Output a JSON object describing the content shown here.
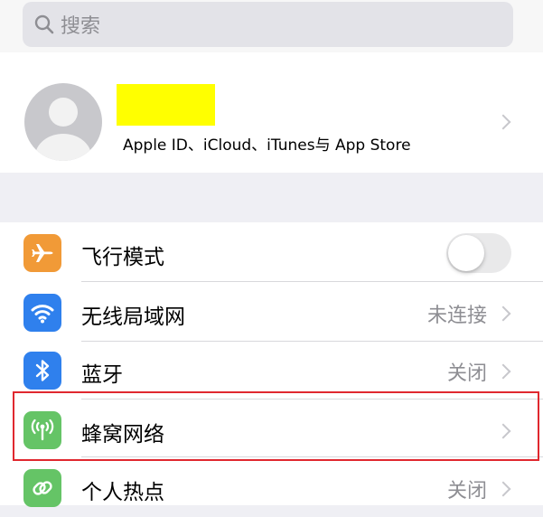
{
  "search": {
    "placeholder": "搜索",
    "icon": "search-icon"
  },
  "profile": {
    "subtitle": "Apple ID、iCloud、iTunes与 App Store",
    "name_redaction_color": "#ffff00",
    "avatar_icon": "person-silhouette-icon"
  },
  "settings": {
    "airplane": {
      "label": "飞行模式",
      "icon": "airplane-icon",
      "icon_color": "#f19a37",
      "toggle_on": false
    },
    "wifi": {
      "label": "无线局域网",
      "value": "未连接",
      "icon": "wifi-icon",
      "icon_color": "#2f80ed"
    },
    "bluetooth": {
      "label": "蓝牙",
      "value": "关闭",
      "icon": "bluetooth-icon",
      "icon_color": "#2f80ed"
    },
    "cellular": {
      "label": "蜂窝网络",
      "icon": "cellular-antenna-icon",
      "icon_color": "#65c466",
      "highlighted": true
    },
    "hotspot": {
      "label": "个人热点",
      "value": "关闭",
      "icon": "hotspot-link-icon",
      "icon_color": "#65c466"
    }
  },
  "highlight_color": "#e0282f"
}
